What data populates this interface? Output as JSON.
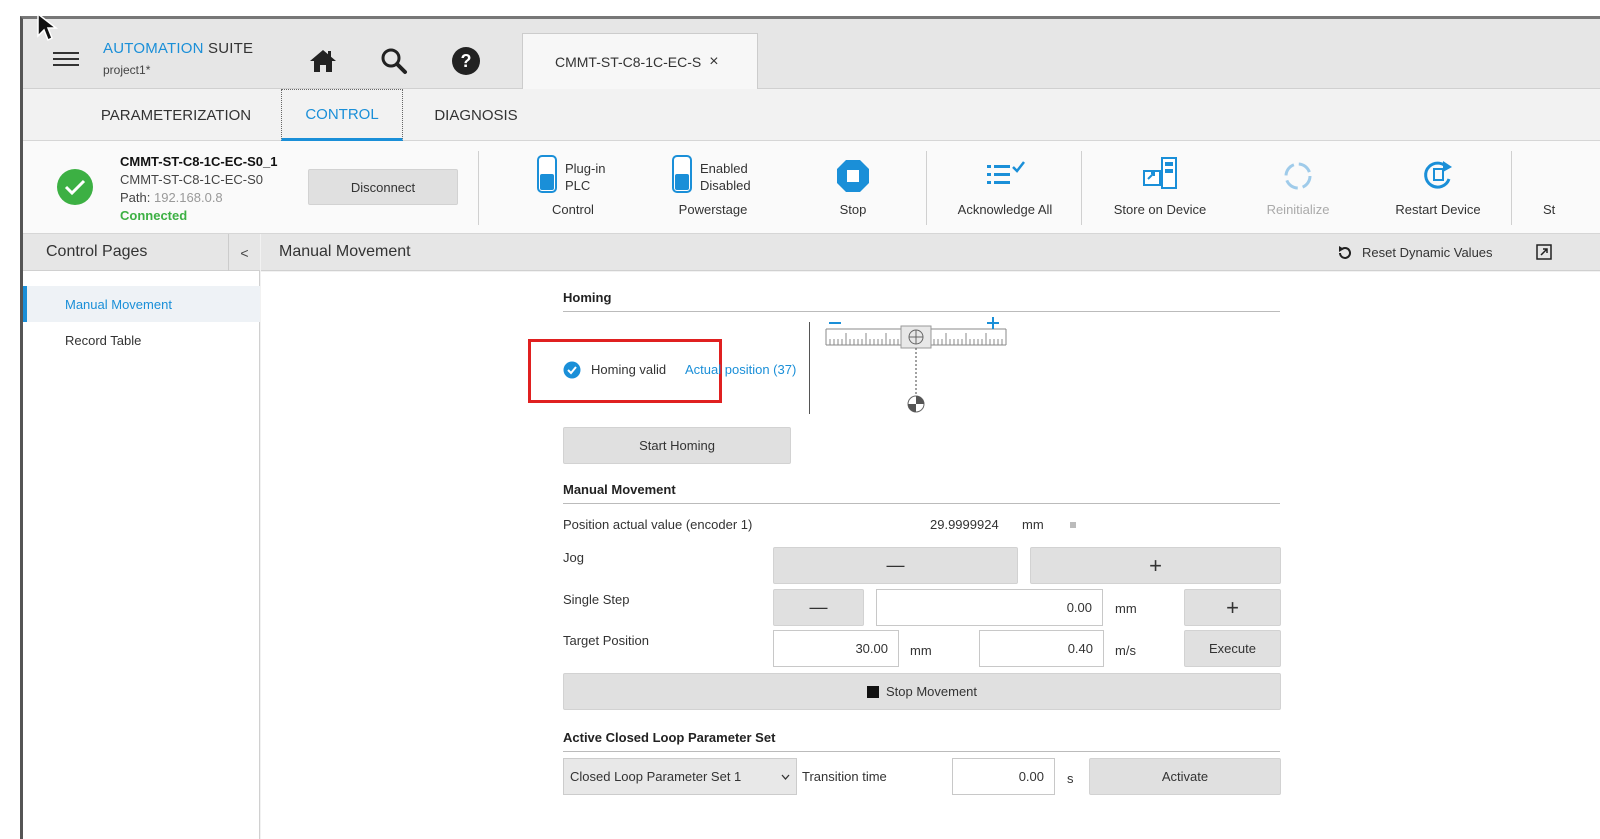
{
  "app": {
    "brand_main": "AUTOMATION",
    "brand_suite": "SUITE",
    "project": "project1*",
    "device_tab": "CMMT-ST-C8-1C-EC-S",
    "close_glyph": "×"
  },
  "tabs": [
    {
      "label": "PARAMETERIZATION"
    },
    {
      "label": "CONTROL"
    },
    {
      "label": "DIAGNOSIS"
    }
  ],
  "device": {
    "name": "CMMT-ST-C8-1C-EC-S0_1",
    "type": "CMMT-ST-C8-1C-EC-S0",
    "path_label": "Path:",
    "path_value": "192.168.0.8",
    "status": "Connected",
    "disconnect_label": "Disconnect"
  },
  "toolbar": {
    "control": {
      "line1": "Plug-in",
      "line2": "PLC",
      "label": "Control"
    },
    "powerstage": {
      "line1": "Enabled",
      "line2": "Disabled",
      "label": "Powerstage"
    },
    "stop": "Stop",
    "acknowledge": "Acknowledge All",
    "store": "Store on Device",
    "reinitialize": "Reinitialize",
    "restart": "Restart Device",
    "cut": "St"
  },
  "sidebar": {
    "title": "Control Pages",
    "collapse_glyph": "<",
    "items": [
      {
        "label": "Manual Movement"
      },
      {
        "label": "Record Table"
      }
    ]
  },
  "page": {
    "title": "Manual Movement",
    "reset_label": "Reset Dynamic Values"
  },
  "homing": {
    "title": "Homing",
    "valid_label": "Homing valid",
    "actual_position_label": "Actual position (37)",
    "start_button": "Start Homing"
  },
  "manual": {
    "title": "Manual Movement",
    "position_label": "Position actual value (encoder 1)",
    "position_value": "29.9999924",
    "position_unit": "mm",
    "jog_label": "Jog",
    "jog_minus": "—",
    "jog_plus": "+",
    "step_label": "Single Step",
    "step_value": "0.00",
    "step_unit": "mm",
    "target_label": "Target Position",
    "target_value": "30.00",
    "target_unit": "mm",
    "velocity_value": "0.40",
    "velocity_unit": "m/s",
    "execute": "Execute",
    "stop_movement": "Stop Movement"
  },
  "closed_loop": {
    "title": "Active Closed Loop Parameter Set",
    "selected": "Closed Loop Parameter Set 1",
    "transition_label": "Transition time",
    "transition_value": "0.00",
    "transition_unit": "s",
    "activate": "Activate"
  },
  "colors": {
    "accent": "#1a8fd8",
    "connected": "#3cb043",
    "highlight": "#e02020"
  }
}
